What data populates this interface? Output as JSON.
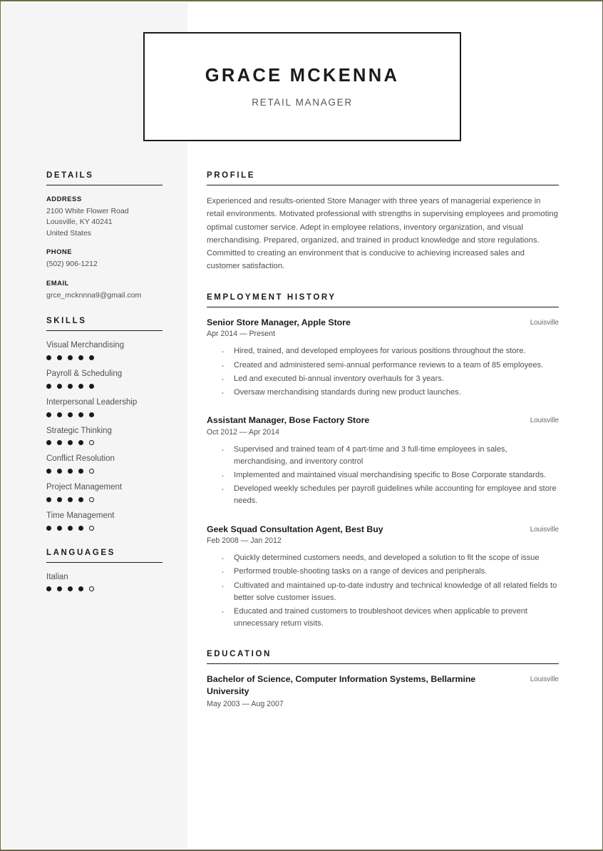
{
  "header": {
    "name": "GRACE MCKENNA",
    "job_title": "RETAIL MANAGER"
  },
  "sidebar": {
    "details": {
      "section_title": "DETAILS",
      "address_label": "ADDRESS",
      "address_line1": "2100 White Flower Road",
      "address_line2": "Lousville, KY 40241",
      "address_line3": "United States",
      "phone_label": "PHONE",
      "phone_value": "(502) 906-1212",
      "email_label": "EMAIL",
      "email_value": "grce_mcknnna9@gmail.com"
    },
    "skills": {
      "section_title": "SKILLS",
      "max_rating": 5,
      "items": [
        {
          "label": "Visual Merchandising",
          "rating": 5
        },
        {
          "label": "Payroll & Scheduling",
          "rating": 5
        },
        {
          "label": "Interpersonal Leadership",
          "rating": 5
        },
        {
          "label": "Strategic Thinking",
          "rating": 4
        },
        {
          "label": "Conflict Resolution",
          "rating": 4
        },
        {
          "label": "Project Management",
          "rating": 4
        },
        {
          "label": "Time Management",
          "rating": 4
        }
      ]
    },
    "languages": {
      "section_title": "LANGUAGES",
      "max_rating": 5,
      "items": [
        {
          "label": "Italian",
          "rating": 4
        }
      ]
    }
  },
  "main": {
    "profile": {
      "section_title": "PROFILE",
      "text": "Experienced and results-oriented Store Manager with three years of managerial experience in retail environments. Motivated professional with strengths in supervising employees and promoting optimal customer service. Adept in employee relations, inventory organization, and visual merchandising. Prepared, organized, and trained in product knowledge and store regulations. Committed to creating an environment that is conducive to achieving increased sales and customer satisfaction."
    },
    "employment": {
      "section_title": "EMPLOYMENT HISTORY",
      "jobs": [
        {
          "role": "Senior Store Manager, Apple Store",
          "location": "Louisville",
          "dates": "Apr 2014 — Present",
          "bullets": [
            "Hired, trained, and developed employees for various positions throughout the store.",
            "Created and administered semi-annual performance reviews to a team of 85 employees.",
            "Led and executed bi-annual inventory overhauls for 3 years.",
            "Oversaw merchandising standards during new product launches."
          ]
        },
        {
          "role": "Assistant Manager, Bose Factory Store",
          "location": "Louisville",
          "dates": "Oct 2012 — Apr 2014",
          "bullets": [
            "Supervised and trained team of 4 part-time and 3 full-time employees in sales, merchandising, and inventory control",
            "Implemented and maintained visual merchandising specific to Bose Corporate standards.",
            "Developed weekly schedules per payroll guidelines while accounting for employee and store needs."
          ]
        },
        {
          "role": "Geek Squad Consultation Agent, Best Buy",
          "location": "Louisville",
          "dates": "Feb 2008 — Jan 2012",
          "bullets": [
            "Quickly determined customers needs, and developed a solution to fit the scope of issue",
            "Performed trouble-shooting tasks on a range of devices and peripherals.",
            "Cultivated and maintained up-to-date industry and technical knowledge of all related fields to better solve customer issues.",
            "Educated and trained customers to troubleshoot devices when applicable to prevent unnecessary return visits."
          ]
        }
      ]
    },
    "education": {
      "section_title": "EDUCATION",
      "items": [
        {
          "degree": "Bachelor of Science, Computer Information Systems, Bellarmine University",
          "location": "Louisville",
          "dates": "May 2003 — Aug 2007"
        }
      ]
    }
  }
}
